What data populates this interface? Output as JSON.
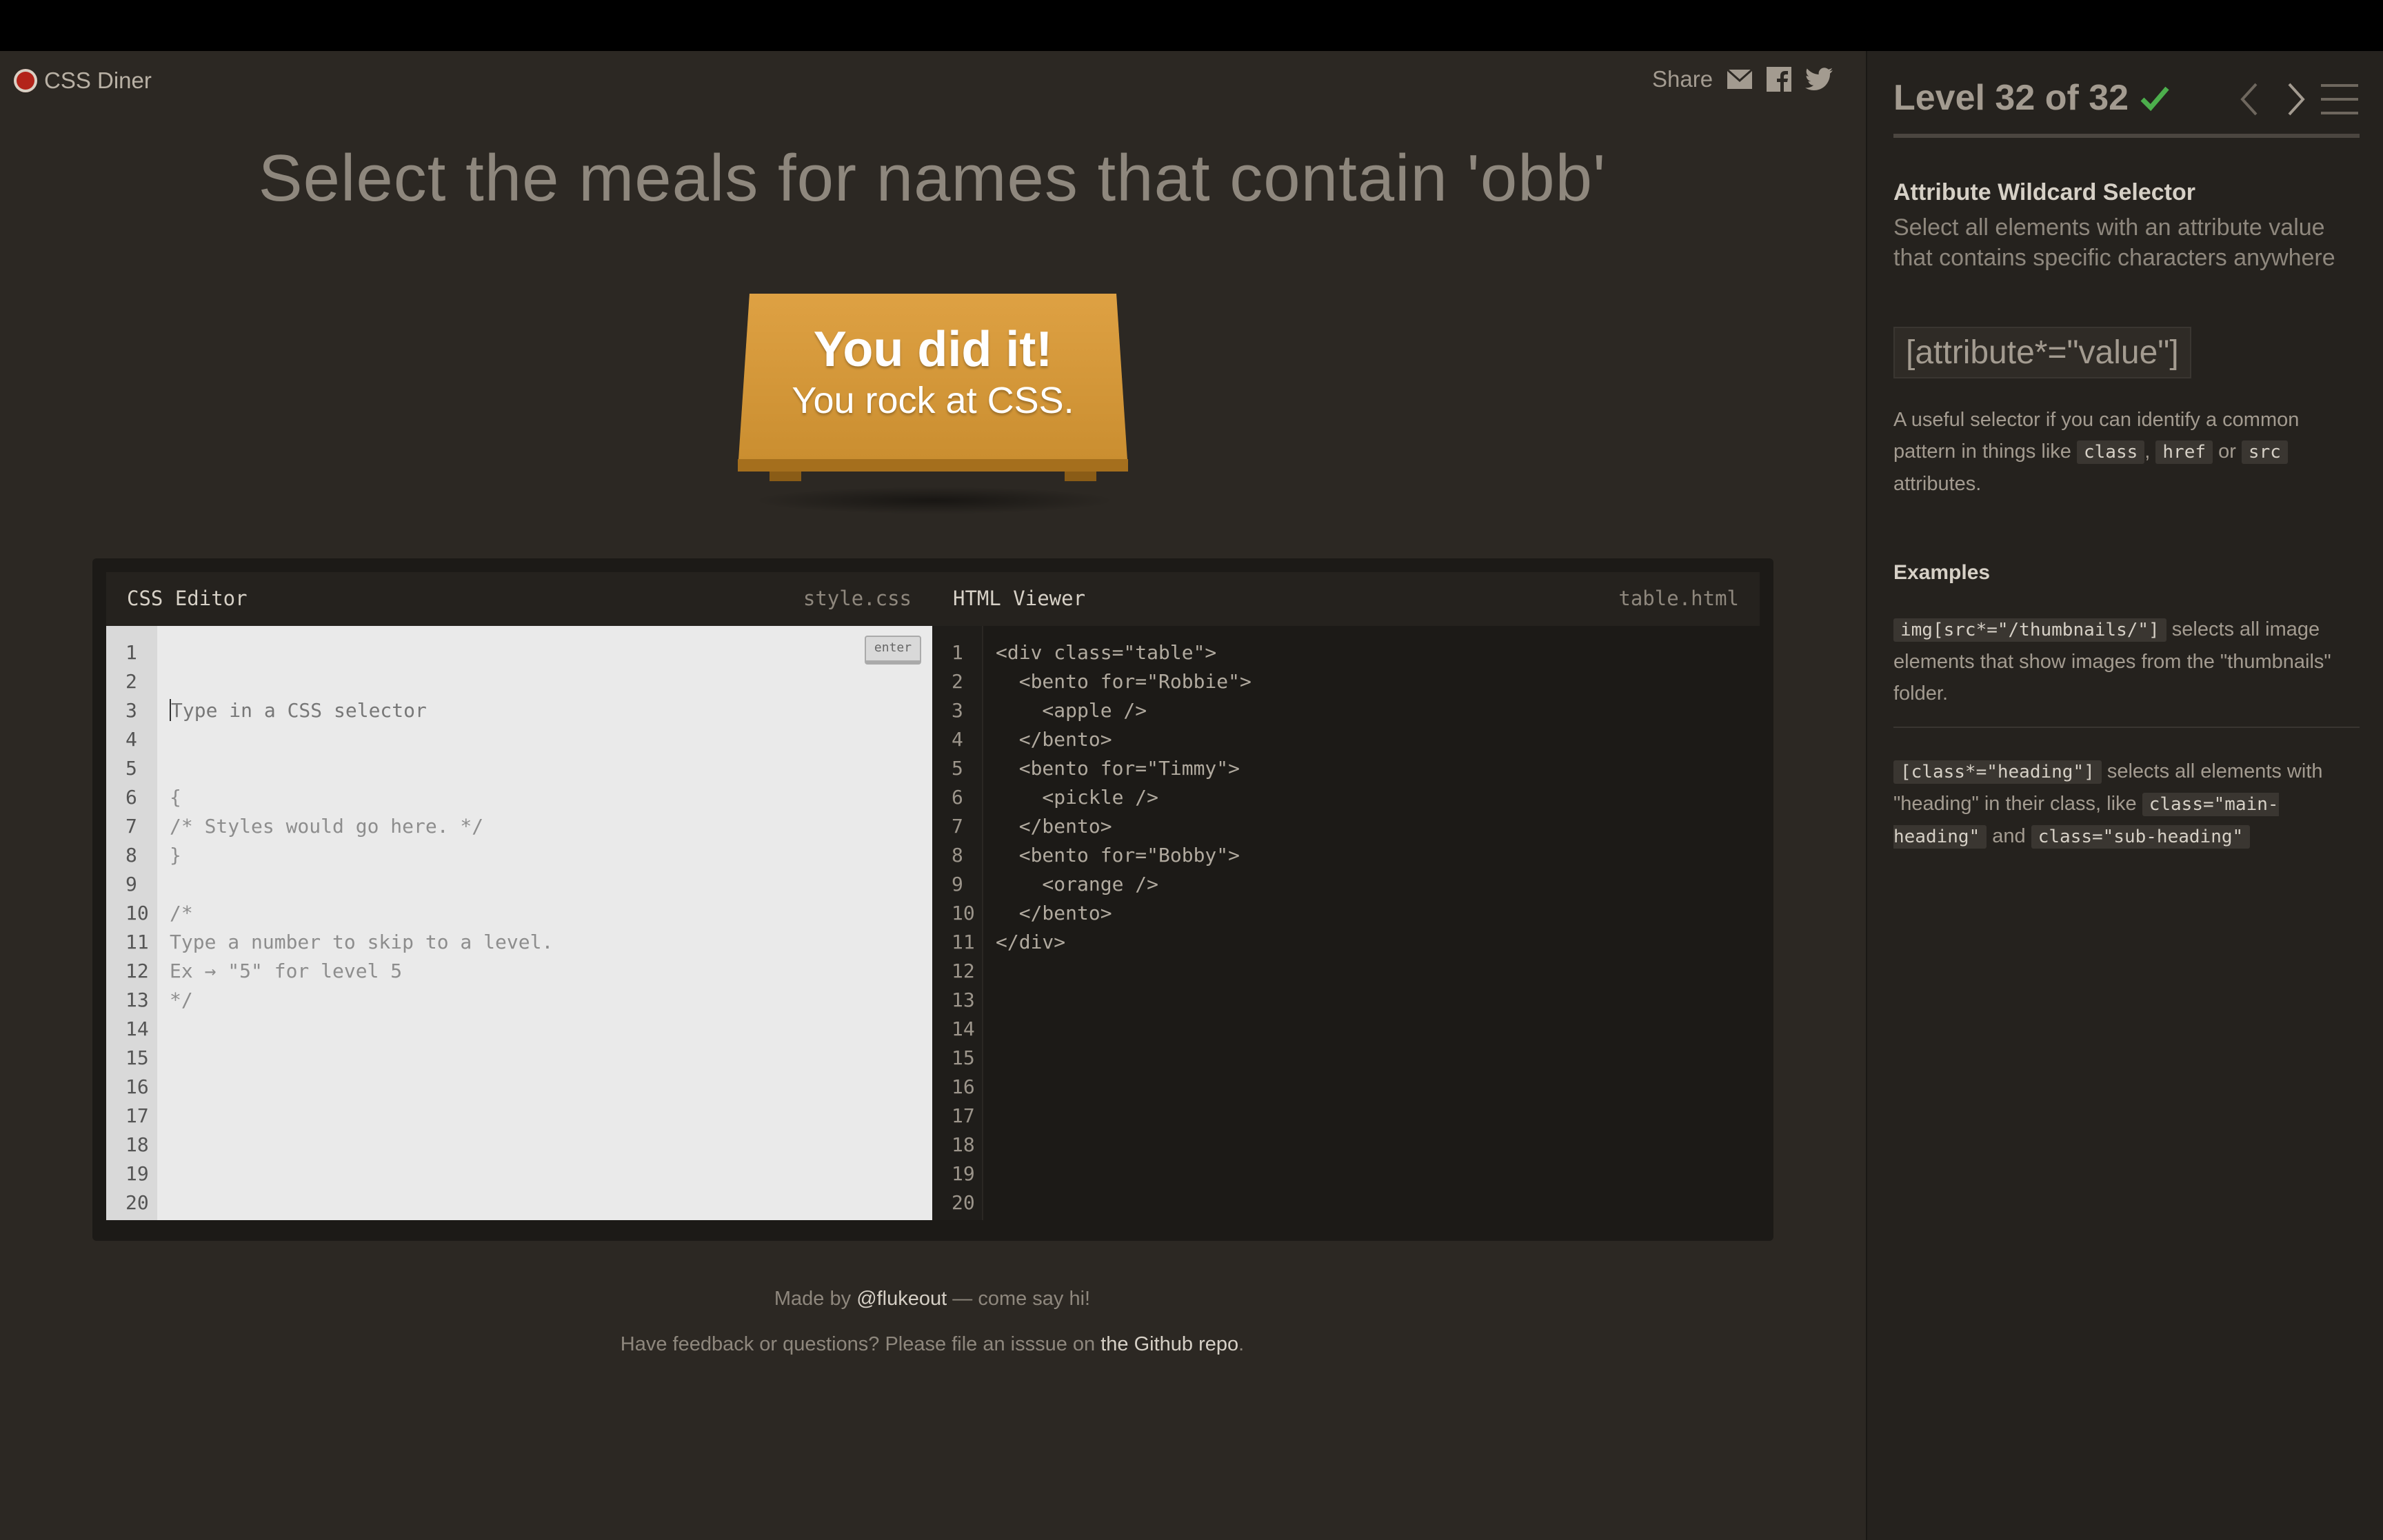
{
  "app": {
    "name": "CSS Diner"
  },
  "share": {
    "label": "Share",
    "icons": [
      "email-icon",
      "facebook-icon",
      "twitter-icon"
    ]
  },
  "headline": "Select the meals for names that contain 'obb'",
  "win": {
    "title": "You did it!",
    "subtitle": "You rock at CSS."
  },
  "css_editor": {
    "title": "CSS Editor",
    "file": "style.css",
    "enter_label": "enter",
    "line_numbers": [
      "1",
      "2",
      "3",
      "4",
      "5",
      "6",
      "7",
      "8",
      "9",
      "10",
      "11",
      "12",
      "13",
      "14",
      "15",
      "16",
      "17",
      "18",
      "19",
      "20"
    ],
    "input_placeholder": "Type in a CSS selector",
    "lines": [
      "{",
      "/* Styles would go here. */",
      "}",
      "",
      "/*",
      "Type a number to skip to a level.",
      "Ex → \"5\" for level 5",
      "*/"
    ]
  },
  "html_viewer": {
    "title": "HTML Viewer",
    "file": "table.html",
    "line_numbers": [
      "1",
      "2",
      "3",
      "4",
      "5",
      "6",
      "7",
      "8",
      "9",
      "10",
      "11",
      "12",
      "13",
      "14",
      "15",
      "16",
      "17",
      "18",
      "19",
      "20"
    ],
    "lines": [
      "<div class=\"table\">",
      "  <bento for=\"Robbie\">",
      "    <apple />",
      "  </bento>",
      "  <bento for=\"Timmy\">",
      "    <pickle />",
      "  </bento>",
      "  <bento for=\"Bobby\">",
      "    <orange />",
      "  </bento>",
      "</div>"
    ]
  },
  "footer": {
    "made_by_prefix": "Made by ",
    "made_by_link": "@flukeout",
    "made_by_suffix": " — come say hi!",
    "feedback_prefix": "Have feedback or questions? Please file an isssue on ",
    "feedback_link": "the Github repo",
    "feedback_suffix": "."
  },
  "sidebar": {
    "level": "Level 32 of 32",
    "completed": true,
    "selector_name": "Attribute Wildcard Selector",
    "selector_desc": "Select all elements with an attribute value that contains specific characters anywhere",
    "syntax": "[attribute*=\"value\"]",
    "help_prefix": "A useful selector if you can identify a common pattern in things like ",
    "help_tags": [
      "class",
      "href",
      "src"
    ],
    "help_sep1": ", ",
    "help_sep2": " or ",
    "help_suffix": " attributes.",
    "examples_heading": "Examples",
    "example1_code": "img[src*=\"/thumbnails/\"]",
    "example1_text": " selects all image elements that show images from the \"thumbnails\" folder.",
    "example2_code": "[class*=\"heading\"]",
    "example2_text1": " selects all elements with \"heading\" in their class, like ",
    "example2_code2": "class=\"main-heading\"",
    "example2_and": " and ",
    "example2_code3": "class=\"sub-heading\""
  },
  "colors": {
    "accent_green": "#4cae4c",
    "table": "#d89a3c",
    "background": "#2c2823",
    "sidebar": "#25221e"
  }
}
